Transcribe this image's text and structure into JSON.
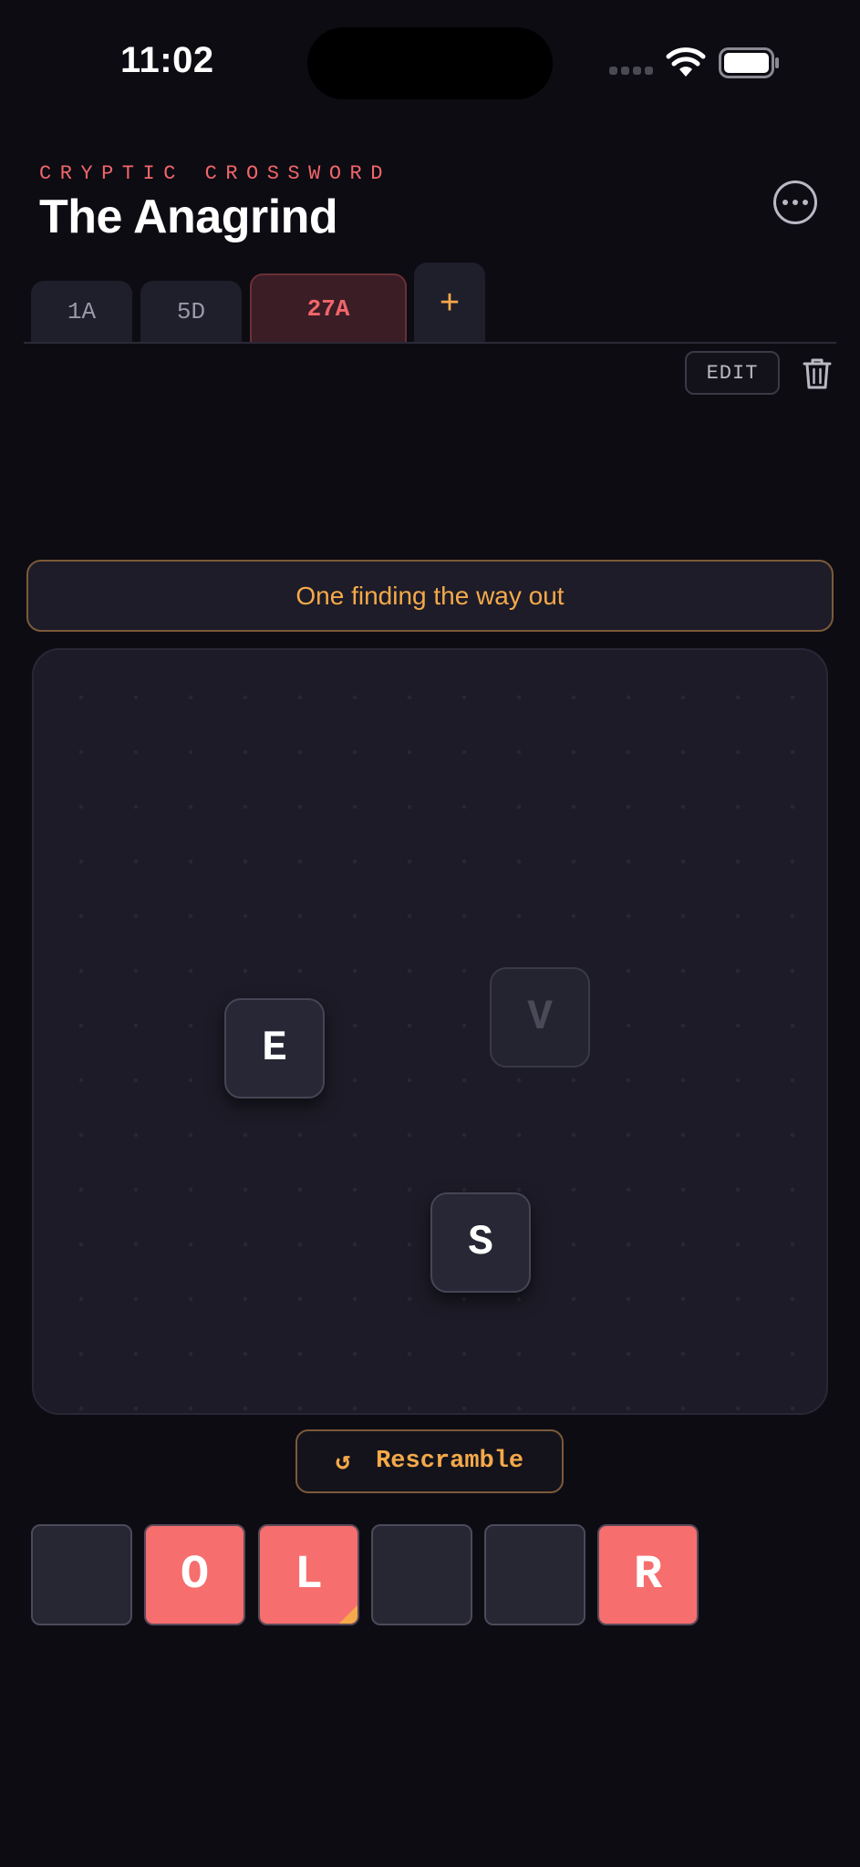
{
  "status": {
    "time": "11:02"
  },
  "header": {
    "eyebrow": "CRYPTIC CROSSWORD",
    "title": "The Anagrind"
  },
  "tabs": [
    {
      "label": "1A",
      "active": false
    },
    {
      "label": "5D",
      "active": false
    },
    {
      "label": "27A",
      "active": true
    }
  ],
  "tab_add_label": "+",
  "toolbar": {
    "edit_label": "EDIT"
  },
  "clue": {
    "text": "One finding the way out"
  },
  "board": {
    "tiles": [
      {
        "letter": "E",
        "state": "active"
      },
      {
        "letter": "V",
        "state": "ghost"
      },
      {
        "letter": "S",
        "state": "active"
      }
    ]
  },
  "rescramble": {
    "icon": "↺",
    "label": "Rescramble"
  },
  "answer": {
    "slots": [
      "",
      "O",
      "L",
      "",
      "",
      "R"
    ],
    "hinted_index": 2
  },
  "colors": {
    "background": "#0d0c13",
    "accent_red": "#f2666a",
    "accent_orange": "#f5a94a",
    "filled_slot": "#f66e6e"
  },
  "icons": [
    "wifi-icon",
    "battery-icon",
    "more-icon",
    "trash-icon",
    "rescramble-icon",
    "plus-icon"
  ]
}
